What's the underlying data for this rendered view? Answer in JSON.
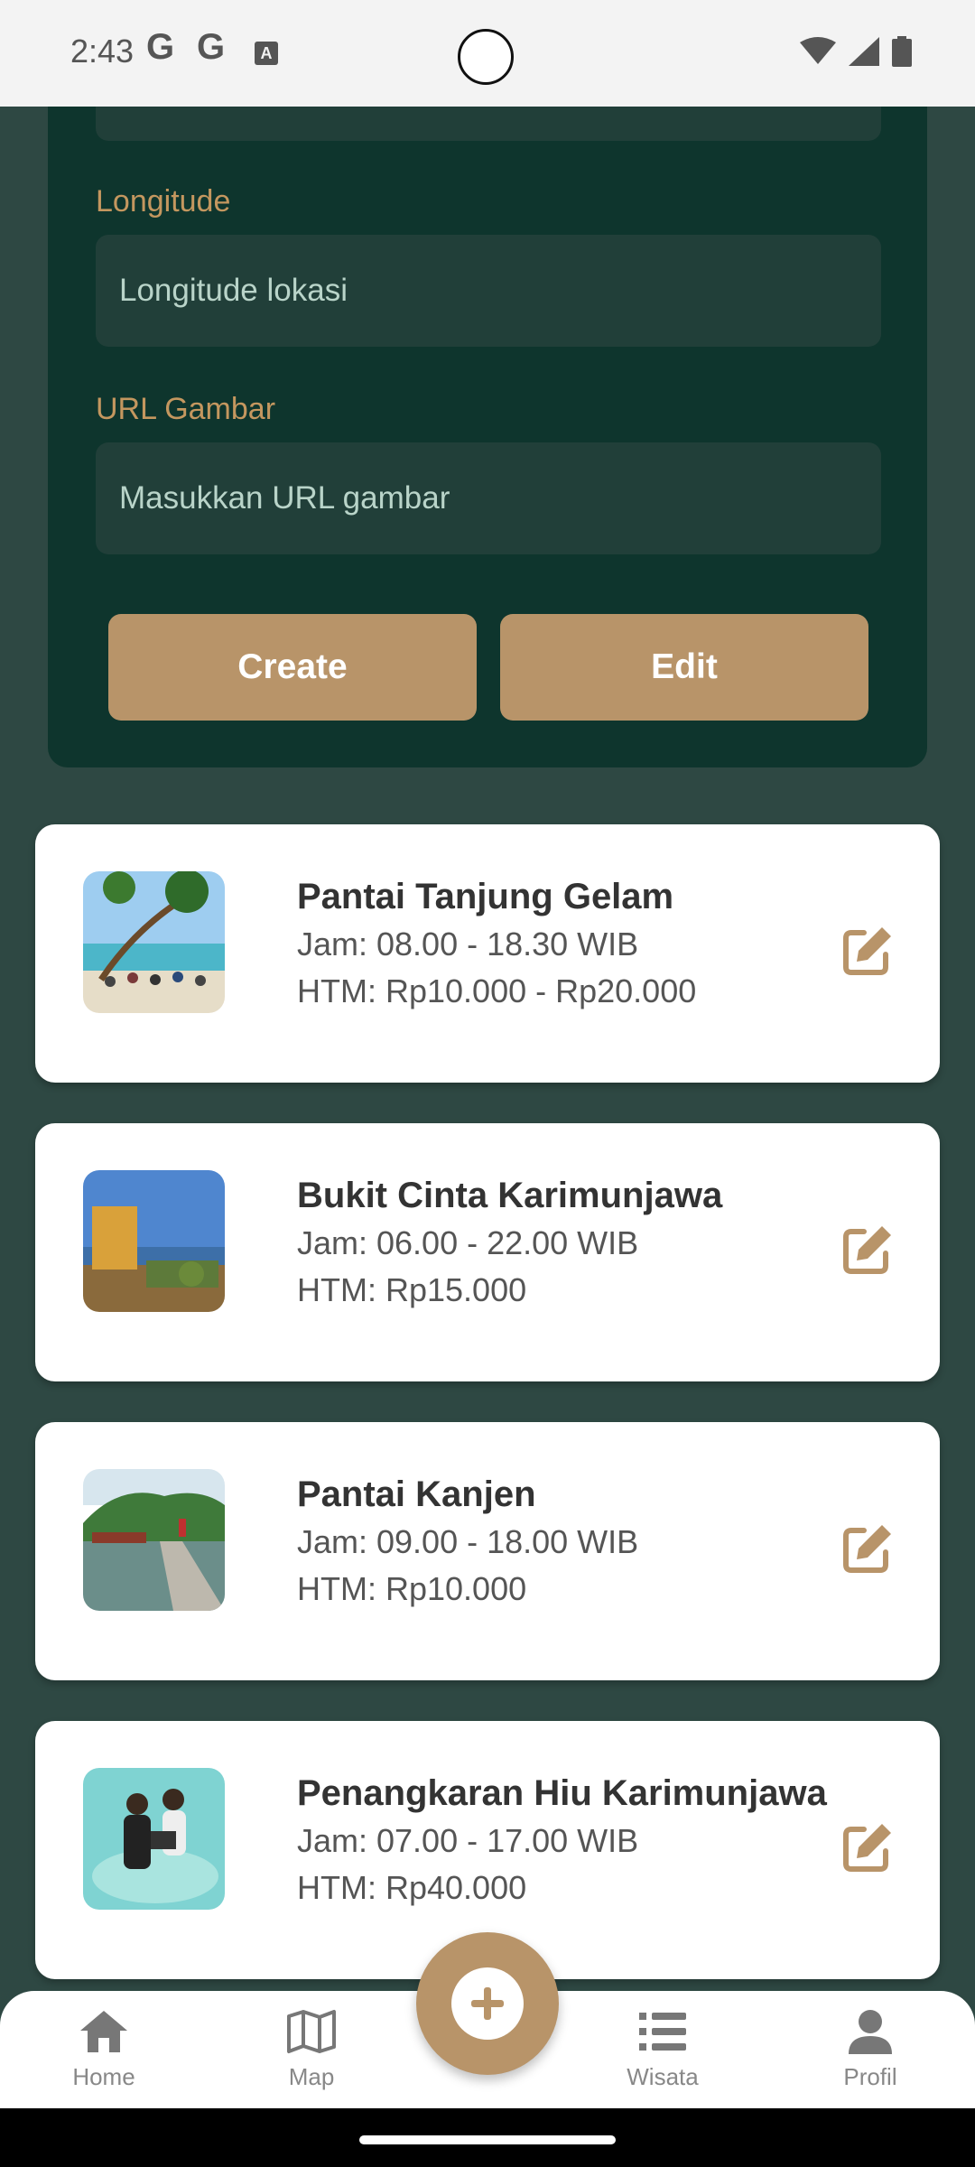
{
  "status_bar": {
    "time": "2:43",
    "icons": [
      "google-icon",
      "google-icon",
      "a-icon",
      "wifi-icon",
      "signal-icon",
      "battery-icon"
    ]
  },
  "form": {
    "longitude_label": "Longitude",
    "longitude_placeholder": "Longitude lokasi",
    "url_label": "URL Gambar",
    "url_placeholder": "Masukkan URL gambar",
    "create_button": "Create",
    "edit_button": "Edit"
  },
  "items": [
    {
      "title": "Pantai Tanjung Gelam",
      "hours": "Jam: 08.00 - 18.30 WIB",
      "price": "HTM: Rp10.000 - Rp20.000"
    },
    {
      "title": "Bukit Cinta Karimunjawa",
      "hours": "Jam: 06.00 - 22.00 WIB",
      "price": "HTM: Rp15.000"
    },
    {
      "title": "Pantai Kanjen",
      "hours": "Jam: 09.00 - 18.00 WIB",
      "price": "HTM: Rp10.000"
    },
    {
      "title": "Penangkaran Hiu Karimunjawa",
      "hours": "Jam: 07.00 - 17.00 WIB",
      "price": "HTM: Rp40.000"
    }
  ],
  "nav": {
    "home": "Home",
    "map": "Map",
    "wisata": "Wisata",
    "profil": "Profil"
  },
  "colors": {
    "accent": "#b89469",
    "panel": "#0e352d",
    "background": "#2e4843",
    "field": "#213f39",
    "label": "#c4975f"
  }
}
